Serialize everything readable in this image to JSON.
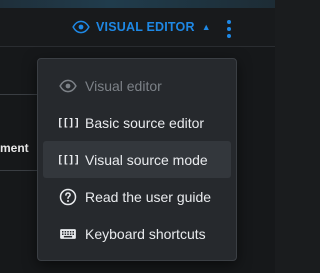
{
  "toolbar": {
    "editor_toggle_label": "VISUAL EDITOR",
    "accent_color": "#1e88e5"
  },
  "background": {
    "partial_label": "ment"
  },
  "menu": {
    "items": [
      {
        "label": "Visual editor",
        "icon": "eye-icon",
        "state": "disabled"
      },
      {
        "label": "Basic source editor",
        "icon": "brackets-icon",
        "state": "normal"
      },
      {
        "label": "Visual source mode",
        "icon": "brackets-icon",
        "state": "highlighted"
      },
      {
        "label": "Read the user guide",
        "icon": "help-circle-icon",
        "state": "normal"
      },
      {
        "label": "Keyboard shortcuts",
        "icon": "keyboard-icon",
        "state": "normal"
      }
    ]
  }
}
